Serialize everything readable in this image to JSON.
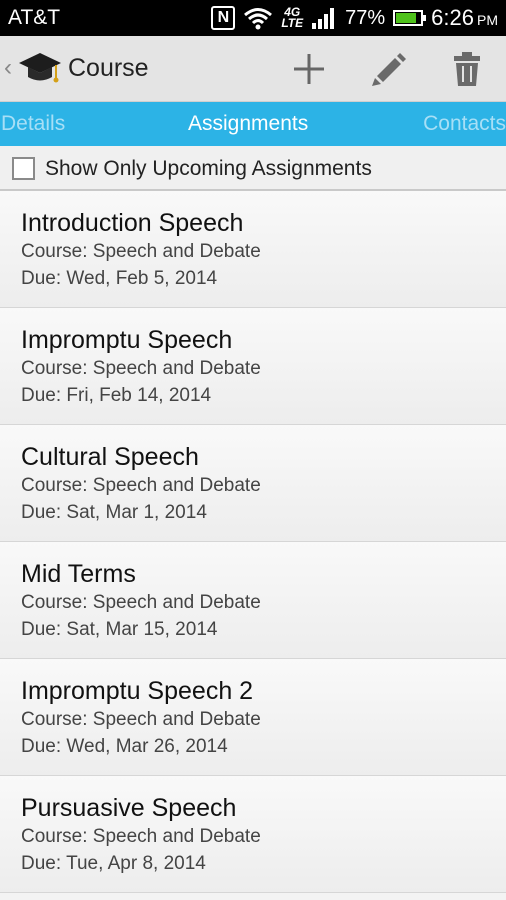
{
  "status_bar": {
    "carrier": "AT&T",
    "nfc_label": "N",
    "network_type": "4G",
    "network_subtype": "LTE",
    "battery_percent": "77%",
    "battery_level": 0.77,
    "time": "6:26",
    "time_suffix": "PM",
    "battery_color": "#4fc21c"
  },
  "action_bar": {
    "back_glyph": "‹",
    "title": "Course",
    "icons": [
      "graduation-cap-icon",
      "add-icon",
      "edit-pencil-icon",
      "trash-icon"
    ]
  },
  "tabs": [
    {
      "label": "Details",
      "active": false
    },
    {
      "label": "Assignments",
      "active": true
    },
    {
      "label": "Contacts",
      "active": false
    }
  ],
  "filter": {
    "label": "Show Only Upcoming Assignments",
    "checked": false
  },
  "assignments": [
    {
      "title": "Introduction Speech",
      "course": "Course: Speech and Debate",
      "due": "Due: Wed, Feb 5, 2014"
    },
    {
      "title": "Impromptu Speech",
      "course": "Course: Speech and Debate",
      "due": "Due: Fri, Feb 14, 2014"
    },
    {
      "title": "Cultural Speech",
      "course": "Course: Speech and Debate",
      "due": "Due: Sat, Mar 1, 2014"
    },
    {
      "title": "Mid Terms",
      "course": "Course: Speech and Debate",
      "due": "Due: Sat, Mar 15, 2014"
    },
    {
      "title": "Impromptu Speech 2",
      "course": "Course: Speech and Debate",
      "due": "Due: Wed, Mar 26, 2014"
    },
    {
      "title": "Pursuasive Speech",
      "course": "Course: Speech and Debate",
      "due": "Due: Tue, Apr 8, 2014"
    }
  ],
  "colors": {
    "tab_bar": "#2cb3e6",
    "action_bar": "#e4e4e4"
  }
}
